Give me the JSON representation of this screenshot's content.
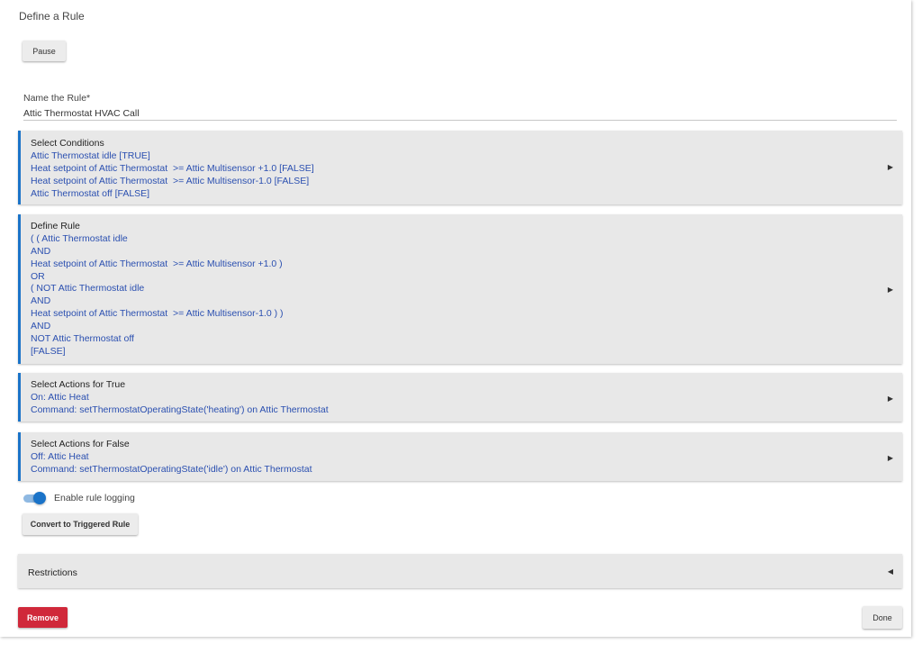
{
  "page": {
    "title": "Define a Rule"
  },
  "buttons": {
    "pause": "Pause",
    "convert": "Convert to Triggered Rule",
    "remove": "Remove",
    "done": "Done"
  },
  "rule_name": {
    "label": "Name the Rule*",
    "value": "Attic Thermostat HVAC Call"
  },
  "sections": [
    {
      "title": "Select Conditions",
      "lines": [
        "Attic Thermostat idle [TRUE]",
        "Heat setpoint of Attic Thermostat  >= Attic Multisensor +1.0 [FALSE]",
        "Heat setpoint of Attic Thermostat  >= Attic Multisensor-1.0 [FALSE]",
        "Attic Thermostat off [FALSE]"
      ]
    },
    {
      "title": "Define Rule",
      "lines": [
        "( ( Attic Thermostat idle",
        "AND",
        "Heat setpoint of Attic Thermostat  >= Attic Multisensor +1.0 )",
        "OR",
        "( NOT Attic Thermostat idle",
        "AND",
        "Heat setpoint of Attic Thermostat  >= Attic Multisensor-1.0 ) )",
        "AND",
        "NOT Attic Thermostat off",
        "[FALSE]"
      ]
    },
    {
      "title": "Select Actions for True",
      "lines": [
        "On: Attic Heat",
        "Command: setThermostatOperatingState('heating') on Attic Thermostat"
      ]
    },
    {
      "title": "Select Actions for False",
      "lines": [
        "Off: Attic Heat",
        "Command: setThermostatOperatingState('idle') on Attic Thermostat"
      ]
    }
  ],
  "logging": {
    "label": "Enable rule logging",
    "enabled": true
  },
  "restrictions": {
    "label": "Restrictions"
  },
  "icons": {
    "expand": "caret-right-icon",
    "collapse": "caret-left-icon"
  },
  "colors": {
    "accent": "#1a73c8",
    "link_text": "#2a4fb0",
    "danger": "#d0283a"
  }
}
